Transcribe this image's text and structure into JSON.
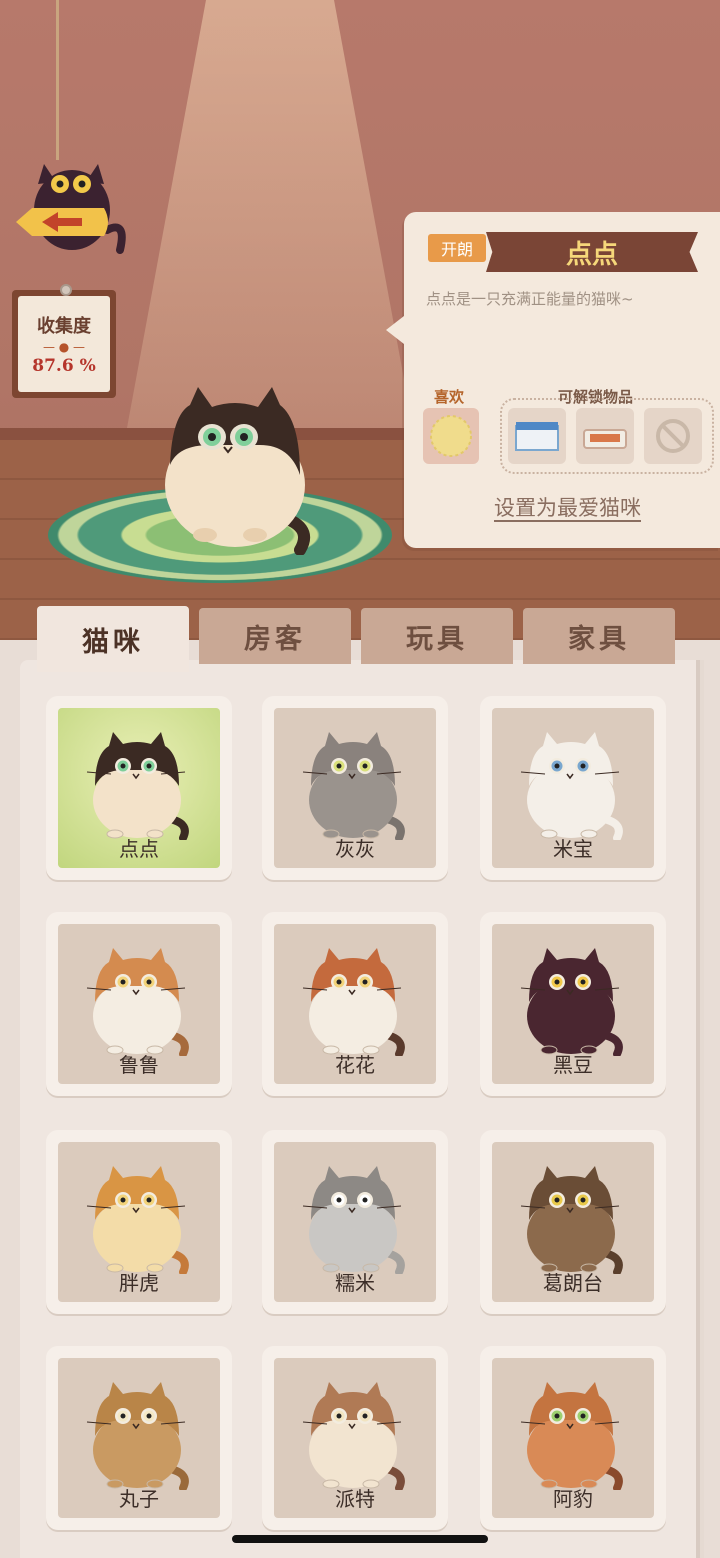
{
  "collection": {
    "title": "收集度",
    "value": "87.6 %"
  },
  "selected_cat": {
    "trait": "开朗",
    "name": "点点",
    "description": "点点是一只充满正能量的猫咪~",
    "likes_label": "喜欢",
    "unlockables_label": "可解锁物品",
    "set_favorite_label": "设置为最爱猫咪"
  },
  "tabs": [
    "猫咪",
    "房客",
    "玩具",
    "家具"
  ],
  "active_tab": "猫咪",
  "cats": [
    {
      "name": "点点",
      "body": "#f3e2c9",
      "top": "#3b2a23",
      "eyes": "#7fcf9a",
      "tail": "#3b2a23",
      "selected": true
    },
    {
      "name": "灰灰",
      "body": "#9a938d",
      "top": "#8a827d",
      "eyes": "#d9e07a",
      "tail": "#7a736e"
    },
    {
      "name": "米宝",
      "body": "#f4efe8",
      "top": "#f4efe8",
      "eyes": "#7aa7cf",
      "tail": "#f4efe8"
    },
    {
      "name": "鲁鲁",
      "body": "#f4ede2",
      "top": "#d48b4f",
      "eyes": "#f2d37a",
      "tail": "#a66a3c"
    },
    {
      "name": "花花",
      "body": "#f4ede2",
      "top": "#c46a3d",
      "eyes": "#f2d37a",
      "tail": "#5a3a2c"
    },
    {
      "name": "黑豆",
      "body": "#4a2630",
      "top": "#4a2630",
      "eyes": "#f2c94a",
      "tail": "#4a2630"
    },
    {
      "name": "胖虎",
      "body": "#f3dca8",
      "top": "#d99544",
      "eyes": "#f2d37a",
      "tail": "#c57a3a"
    },
    {
      "name": "糯米",
      "body": "#c9c7c4",
      "top": "#8d8985",
      "eyes": "#ffffff",
      "tail": "#a5a29e"
    },
    {
      "name": "葛朗台",
      "body": "#8c6a4c",
      "top": "#6a4d36",
      "eyes": "#e8c94a",
      "tail": "#5a3f2c"
    },
    {
      "name": "丸子",
      "body": "#c99a62",
      "top": "#b98548",
      "eyes": "#f3e8c6",
      "tail": "#9a6a3a"
    },
    {
      "name": "派特",
      "body": "#f2e4d0",
      "top": "#b07a55",
      "eyes": "#f2e4c0",
      "tail": "#7a4d3a"
    },
    {
      "name": "阿豹",
      "body": "#d98a56",
      "top": "#c47440",
      "eyes": "#9ccf6e",
      "tail": "#8a4a2c"
    }
  ]
}
